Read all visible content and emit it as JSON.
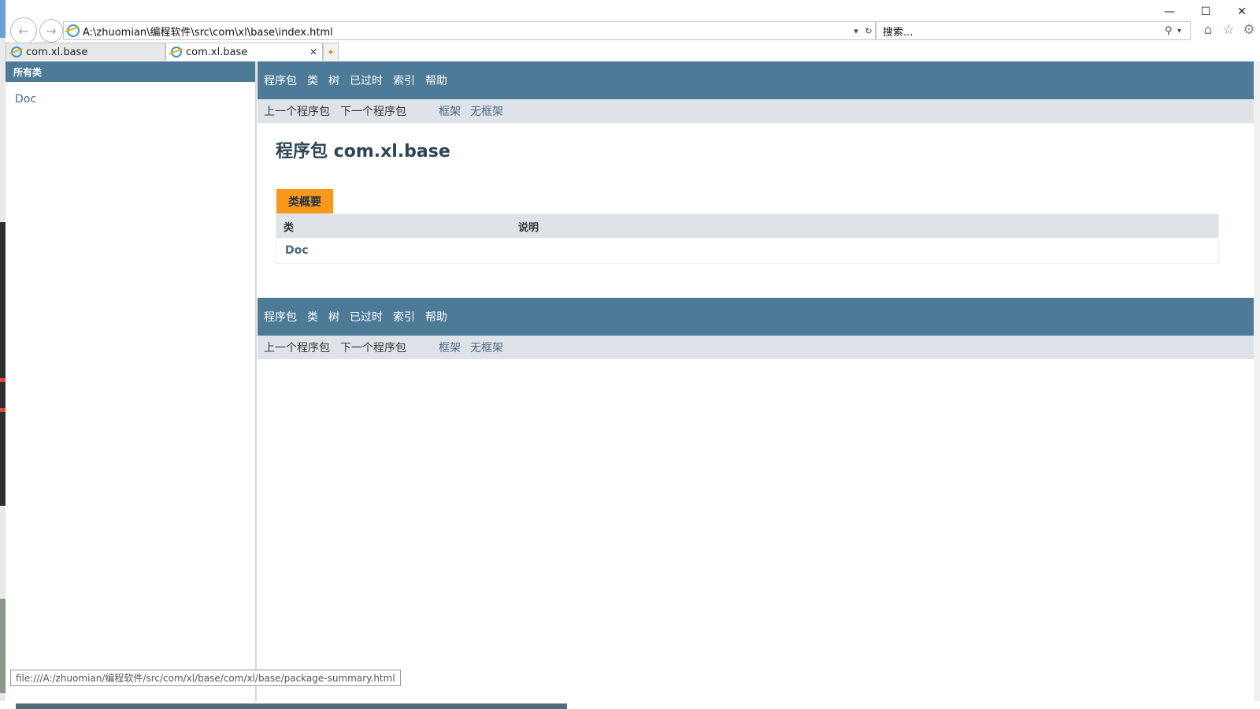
{
  "window": {
    "controls": [
      "—",
      "☐",
      "✕"
    ]
  },
  "address_bar": {
    "url": "A:\\zhuomian\\编程软件\\src\\com\\xl\\base\\index.html"
  },
  "search_box": {
    "placeholder": "搜索..."
  },
  "tabs": [
    {
      "title": "com.xl.base",
      "active": false
    },
    {
      "title": "com.xl.base",
      "active": true
    }
  ],
  "left_frame": {
    "header": "所有类",
    "classes": [
      "Doc"
    ]
  },
  "top_nav": {
    "items": [
      "程序包",
      "类",
      "树",
      "已过时",
      "索引",
      "帮助"
    ]
  },
  "sub_nav": {
    "prev": "上一个程序包",
    "next": "下一个程序包",
    "frames": "框架",
    "no_frames": "无框架"
  },
  "page": {
    "title": "程序包 com.xl.base",
    "summary_caption": "类概要",
    "table_headers": [
      "类",
      "说明"
    ],
    "table_rows": [
      {
        "class": "Doc",
        "description": ""
      }
    ]
  },
  "status_bar": {
    "text": "file:///A:/zhuomian/编程软件/src/com/xl/base/com/xl/base/package-summary.html"
  },
  "colors": {
    "nav_bg": "#4d7a97",
    "subnav_bg": "#dee3e9",
    "caption_bg": "#f8981d",
    "link": "#4a6782"
  }
}
